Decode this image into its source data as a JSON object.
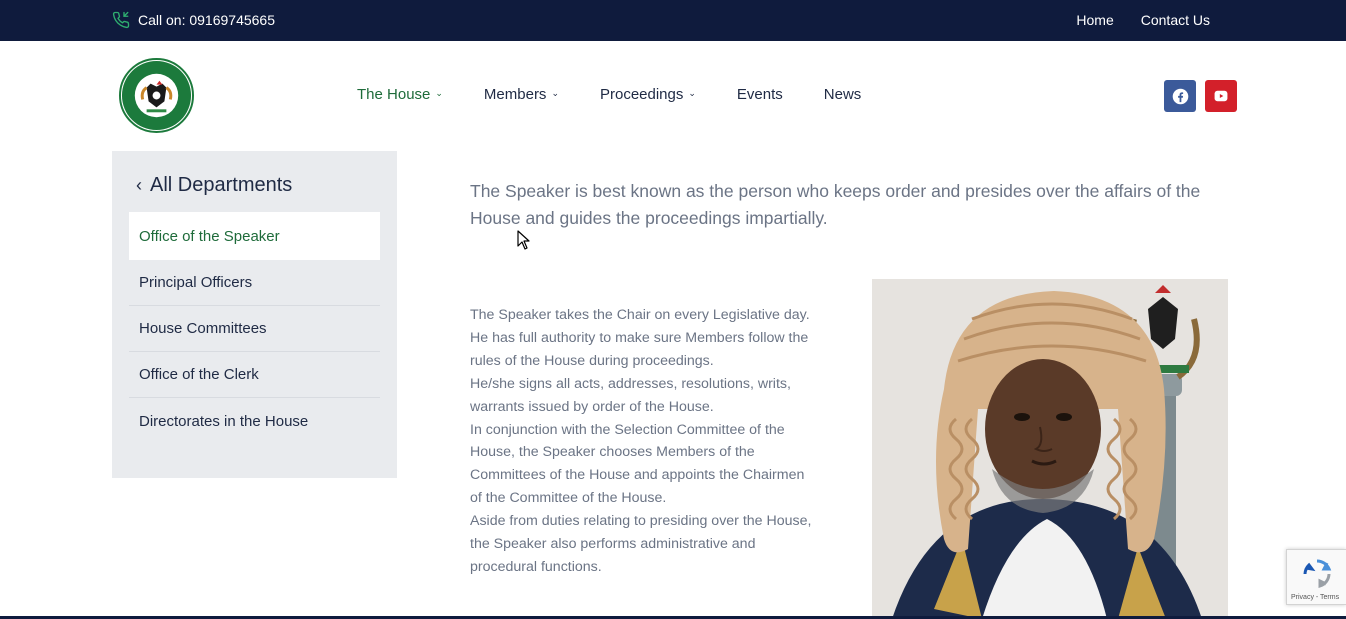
{
  "topbar": {
    "phone_label": "Call on: 09169745665",
    "links": [
      "Home",
      "Contact Us"
    ]
  },
  "logo": {
    "alt": "Imo State House of Assembly"
  },
  "nav": {
    "items": [
      {
        "label": "The House",
        "has_dropdown": true,
        "active": true
      },
      {
        "label": "Members",
        "has_dropdown": true,
        "active": false
      },
      {
        "label": "Proceedings",
        "has_dropdown": true,
        "active": false
      },
      {
        "label": "Events",
        "has_dropdown": false,
        "active": false
      },
      {
        "label": "News",
        "has_dropdown": false,
        "active": false
      }
    ]
  },
  "social": {
    "facebook_icon": "facebook-icon",
    "youtube_icon": "youtube-icon"
  },
  "sidebar": {
    "heading": "All Departments",
    "items": [
      {
        "label": "Office of the Speaker",
        "active": true
      },
      {
        "label": "Principal Officers",
        "active": false
      },
      {
        "label": "House Committees",
        "active": false
      },
      {
        "label": "Office of the Clerk",
        "active": false
      },
      {
        "label": "Directorates in the House",
        "active": false
      }
    ]
  },
  "content": {
    "lead": "The Speaker is best known as the person who keeps order and presides over the affairs of the House and guides the proceedings impartially.",
    "lines": [
      "The Speaker takes the Chair on every Legislative day.",
      "He has full authority to make sure Members follow the",
      "rules of the House during proceedings.",
      "He/she signs all acts, addresses, resolutions, writs,",
      "warrants issued by order of the House.",
      "In conjunction with the Selection Committee of the",
      "House, the Speaker chooses Members of the",
      "Committees of the House and appoints the Chairmen",
      "of the Committee of the House.",
      "Aside from duties relating to presiding over the House,",
      "the Speaker also performs administrative and",
      "procedural functions."
    ]
  },
  "recaptcha": {
    "footer": "Privacy - Terms"
  },
  "colors": {
    "topbar_bg": "#0f1b3d",
    "accent_green": "#1e6b3a",
    "facebook": "#3b5a9a",
    "youtube": "#d3202a"
  }
}
